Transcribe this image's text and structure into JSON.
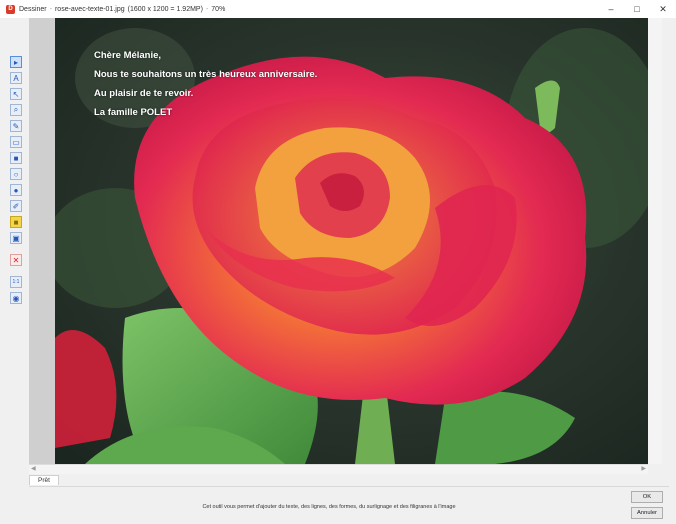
{
  "window": {
    "app_name": "Dessiner",
    "file_name": "rose-avec-texte-01.jpg",
    "image_info": "(1600 x 1200 = 1.92MP)",
    "zoom": "70%",
    "separator": "-",
    "minimize": "–",
    "maximize": "□",
    "close": "✕"
  },
  "toolbar": {
    "tools": [
      {
        "name": "select",
        "icon": "select-icon",
        "glyph": "▸"
      },
      {
        "name": "text",
        "icon": "text-icon",
        "glyph": "A"
      },
      {
        "name": "arrow",
        "icon": "arrow-icon",
        "glyph": "↖"
      },
      {
        "name": "zoom",
        "icon": "zoom-icon",
        "glyph": "⌕"
      },
      {
        "name": "pen",
        "icon": "pen-icon",
        "glyph": "✎"
      },
      {
        "name": "rectangle",
        "icon": "rectangle-icon",
        "glyph": "▭"
      },
      {
        "name": "filled-rectangle",
        "icon": "filled-rectangle-icon",
        "glyph": "■"
      },
      {
        "name": "ellipse",
        "icon": "ellipse-icon",
        "glyph": "○"
      },
      {
        "name": "filled-ellipse",
        "icon": "filled-ellipse-icon",
        "glyph": "●"
      },
      {
        "name": "highlighter",
        "icon": "highlighter-icon",
        "glyph": "✐"
      },
      {
        "name": "color",
        "icon": "color-icon",
        "glyph": "■"
      },
      {
        "name": "image",
        "icon": "image-icon",
        "glyph": "▣"
      },
      {
        "name": "delete",
        "icon": "delete-icon",
        "glyph": "✕"
      },
      {
        "name": "actual-size",
        "icon": "actual-size-icon",
        "glyph": "1:1"
      },
      {
        "name": "fit",
        "icon": "fit-icon",
        "glyph": "◉"
      }
    ]
  },
  "overlay_text": {
    "line1": "Chère Mélanie,",
    "line2": "Nous te souhaitons un très heureux anniversaire.",
    "line3": "Au plaisir de te revoir.",
    "line4": "La famille POLET"
  },
  "status": {
    "ready": "Prêt"
  },
  "help_text": "Cet outil vous permet d'ajouter du texte, des lignes, des formes, du surlignage et des filigranes à l'image",
  "buttons": {
    "ok": "OK",
    "cancel": "Annuler"
  },
  "colors": {
    "accent": "#2857b8",
    "petal": "#e0234a",
    "petal_center": "#f5a623",
    "leaf": "#5aa84a",
    "background": "#2d3a2e"
  }
}
